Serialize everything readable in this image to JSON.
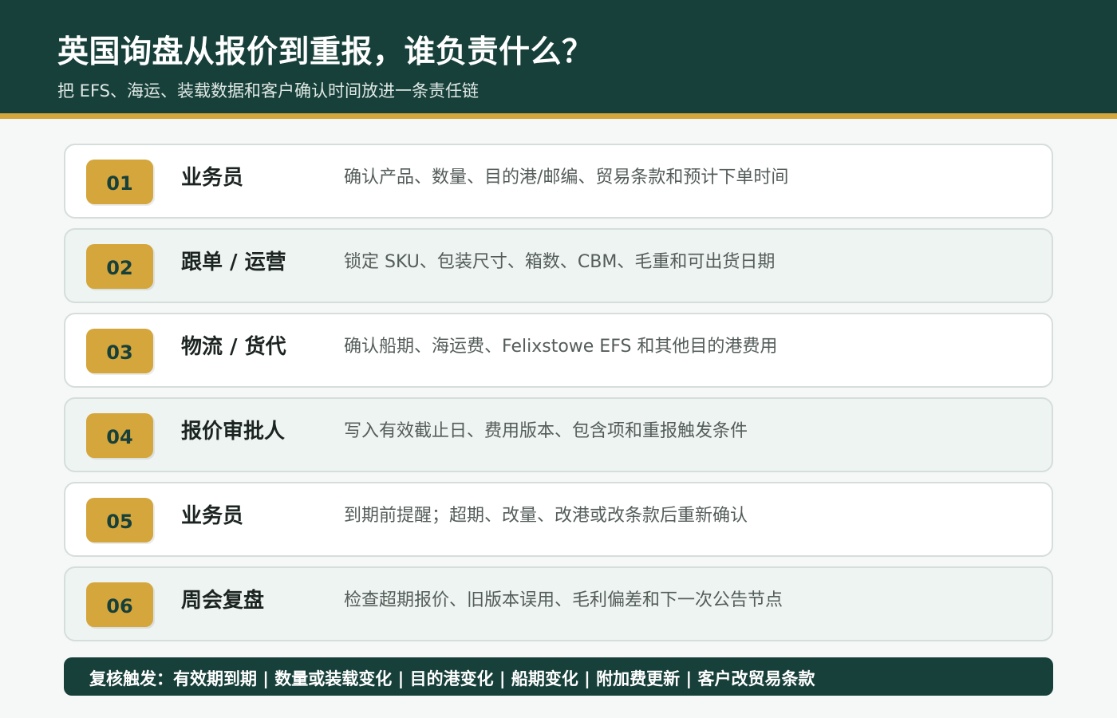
{
  "header": {
    "title": "英国询盘从报价到重报，谁负责什么？",
    "subtitle": "把 EFS、海运、装载数据和客户确认时间放进一条责任链"
  },
  "steps": [
    {
      "number": "01",
      "role": "业务员",
      "description": "确认产品、数量、目的港/邮编、贸易条款和预计下单时间"
    },
    {
      "number": "02",
      "role": "跟单 / 运营",
      "description": "锁定 SKU、包装尺寸、箱数、CBM、毛重和可出货日期"
    },
    {
      "number": "03",
      "role": "物流 / 货代",
      "description": "确认船期、海运费、Felixstowe EFS 和其他目的港费用"
    },
    {
      "number": "04",
      "role": "报价审批人",
      "description": "写入有效截止日、费用版本、包含项和重报触发条件"
    },
    {
      "number": "05",
      "role": "业务员",
      "description": "到期前提醒；超期、改量、改港或改条款后重新确认"
    },
    {
      "number": "06",
      "role": "周会复盘",
      "description": "检查超期报价、旧版本误用、毛利偏差和下一次公告节点"
    }
  ],
  "footer": {
    "text": "复核触发：有效期到期 | 数量或装载变化 | 目的港变化 | 船期变化 | 附加费更新 | 客户改贸易条款"
  },
  "colors": {
    "header_bg": "#18403a",
    "accent_gold": "#d4a63c",
    "card_bg": "#ffffff",
    "card_alt_bg": "#eef4f1"
  }
}
